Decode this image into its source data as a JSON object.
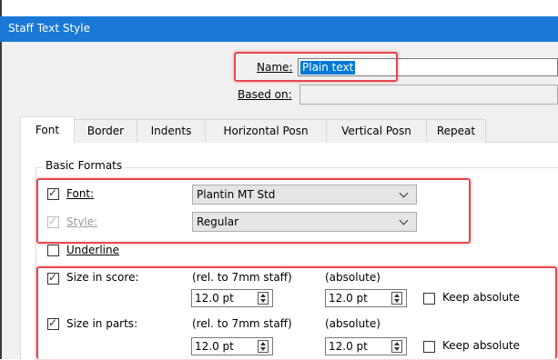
{
  "window": {
    "title": "Staff Text Style"
  },
  "name_field": {
    "label": "Name:",
    "value": "Plain text"
  },
  "based_on": {
    "label": "Based on:",
    "value": ""
  },
  "tabs": [
    {
      "label": "Font",
      "active": true
    },
    {
      "label": "Border"
    },
    {
      "label": "Indents"
    },
    {
      "label": "Horizontal Posn"
    },
    {
      "label": "Vertical Posn"
    },
    {
      "label": "Repeat"
    }
  ],
  "basic_formats": {
    "label": "Basic Formats",
    "font": {
      "label": "Font:",
      "checked": true,
      "value": "Plantin MT Std"
    },
    "style": {
      "label": "Style:",
      "checked": true,
      "disabled": true,
      "value": "Regular"
    },
    "underline": {
      "label": "Underline",
      "checked": false
    }
  },
  "size_score": {
    "label": "Size in score:",
    "checked": true,
    "rel_header": "(rel. to 7mm staff)",
    "abs_header": "(absolute)",
    "rel_value": "12.0 pt",
    "abs_value": "12.0 pt",
    "keep_label": "Keep absolute",
    "keep_checked": false
  },
  "size_parts": {
    "label": "Size in parts:",
    "checked": true,
    "rel_header": "(rel. to 7mm staff)",
    "abs_header": "(absolute)",
    "rel_value": "12.0 pt",
    "abs_value": "12.0 pt",
    "keep_label": "Keep absolute",
    "keep_checked": false
  },
  "colors": {
    "titlebar": "#1a78d6",
    "highlight": "#e8474d",
    "selection": "#0078d7"
  }
}
